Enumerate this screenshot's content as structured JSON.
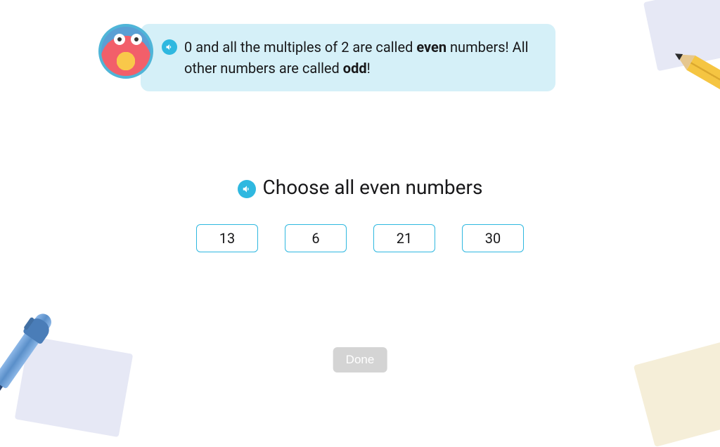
{
  "hint": {
    "text_prefix": "0 and all the multiples of 2 are called ",
    "bold1": "even",
    "text_mid": " numbers! All other numbers are called ",
    "bold2": "odd",
    "text_suffix": "!"
  },
  "question": {
    "prompt": "Choose all even numbers"
  },
  "options": [
    "13",
    "6",
    "21",
    "30"
  ],
  "done_label": "Done"
}
